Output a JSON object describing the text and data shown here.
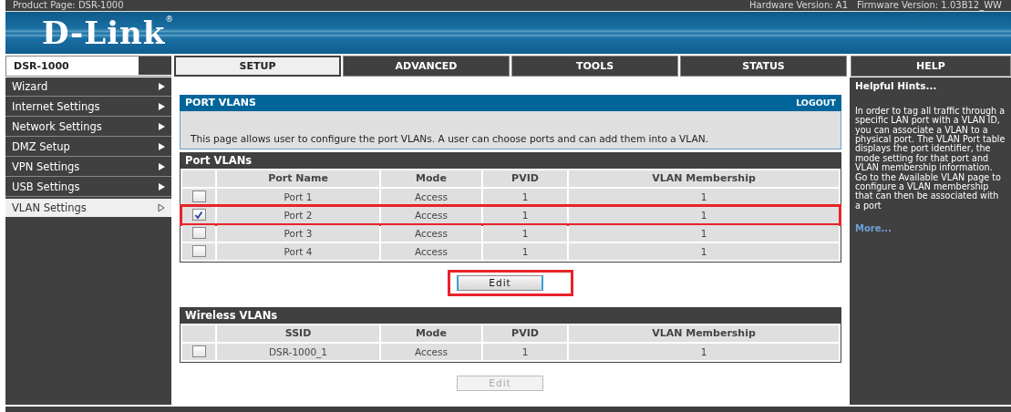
{
  "top_bar": {
    "product": "Product Page: DSR-1000",
    "hardware": "Hardware Version: A1",
    "firmware": "Firmware Version: 1.03B12_WW"
  },
  "logo": {
    "text": "D-Link",
    "mark": "®"
  },
  "device": "DSR-1000",
  "tabs": [
    {
      "label": "SETUP",
      "selected": true
    },
    {
      "label": "ADVANCED",
      "selected": false
    },
    {
      "label": "TOOLS",
      "selected": false
    },
    {
      "label": "STATUS",
      "selected": false
    }
  ],
  "help_tab": "HELP",
  "sidebar": {
    "items": [
      {
        "label": "Wizard",
        "selected": false
      },
      {
        "label": "Internet Settings",
        "selected": false
      },
      {
        "label": "Network Settings",
        "selected": false
      },
      {
        "label": "DMZ Setup",
        "selected": false
      },
      {
        "label": "VPN Settings",
        "selected": false
      },
      {
        "label": "USB Settings",
        "selected": false
      },
      {
        "label": "VLAN Settings",
        "selected": true
      }
    ]
  },
  "page": {
    "title": "PORT VLANS",
    "logout": "LOGOUT",
    "description": "This page allows user to configure the port VLANs. A user can choose ports and can add them into a VLAN."
  },
  "sections": [
    {
      "title": "Port VLANs",
      "columns": [
        "Port Name",
        "Mode",
        "PVID",
        "VLAN Membership"
      ],
      "rows": [
        {
          "cells": [
            "Port 1",
            "Access",
            "1",
            "1"
          ],
          "checked": false,
          "highlighted": false
        },
        {
          "cells": [
            "Port 2",
            "Access",
            "1",
            "1"
          ],
          "checked": true,
          "highlighted": true
        },
        {
          "cells": [
            "Port 3",
            "Access",
            "1",
            "1"
          ],
          "checked": false,
          "highlighted": false
        },
        {
          "cells": [
            "Port 4",
            "Access",
            "1",
            "1"
          ],
          "checked": false,
          "highlighted": false
        }
      ],
      "button": {
        "label": "Edit",
        "disabled": false,
        "highlighted": true
      }
    },
    {
      "title": "Wireless VLANs",
      "columns": [
        "SSID",
        "Mode",
        "PVID",
        "VLAN Membership"
      ],
      "rows": [
        {
          "cells": [
            "DSR-1000_1",
            "Access",
            "1",
            "1"
          ],
          "checked": false,
          "highlighted": false
        }
      ],
      "button": {
        "label": "Edit",
        "disabled": true,
        "highlighted": false
      }
    }
  ],
  "help": {
    "title": "Helpful Hints...",
    "text": "In order to tag all traffic through a specific LAN port with a VLAN ID, you can associate a VLAN to a physical port. The VLAN Port table displays the port identifier, the mode setting for that port and VLAN membership information. Go to the Available VLAN page to configure a VLAN membership that can then be associated with a port",
    "more": "More..."
  }
}
